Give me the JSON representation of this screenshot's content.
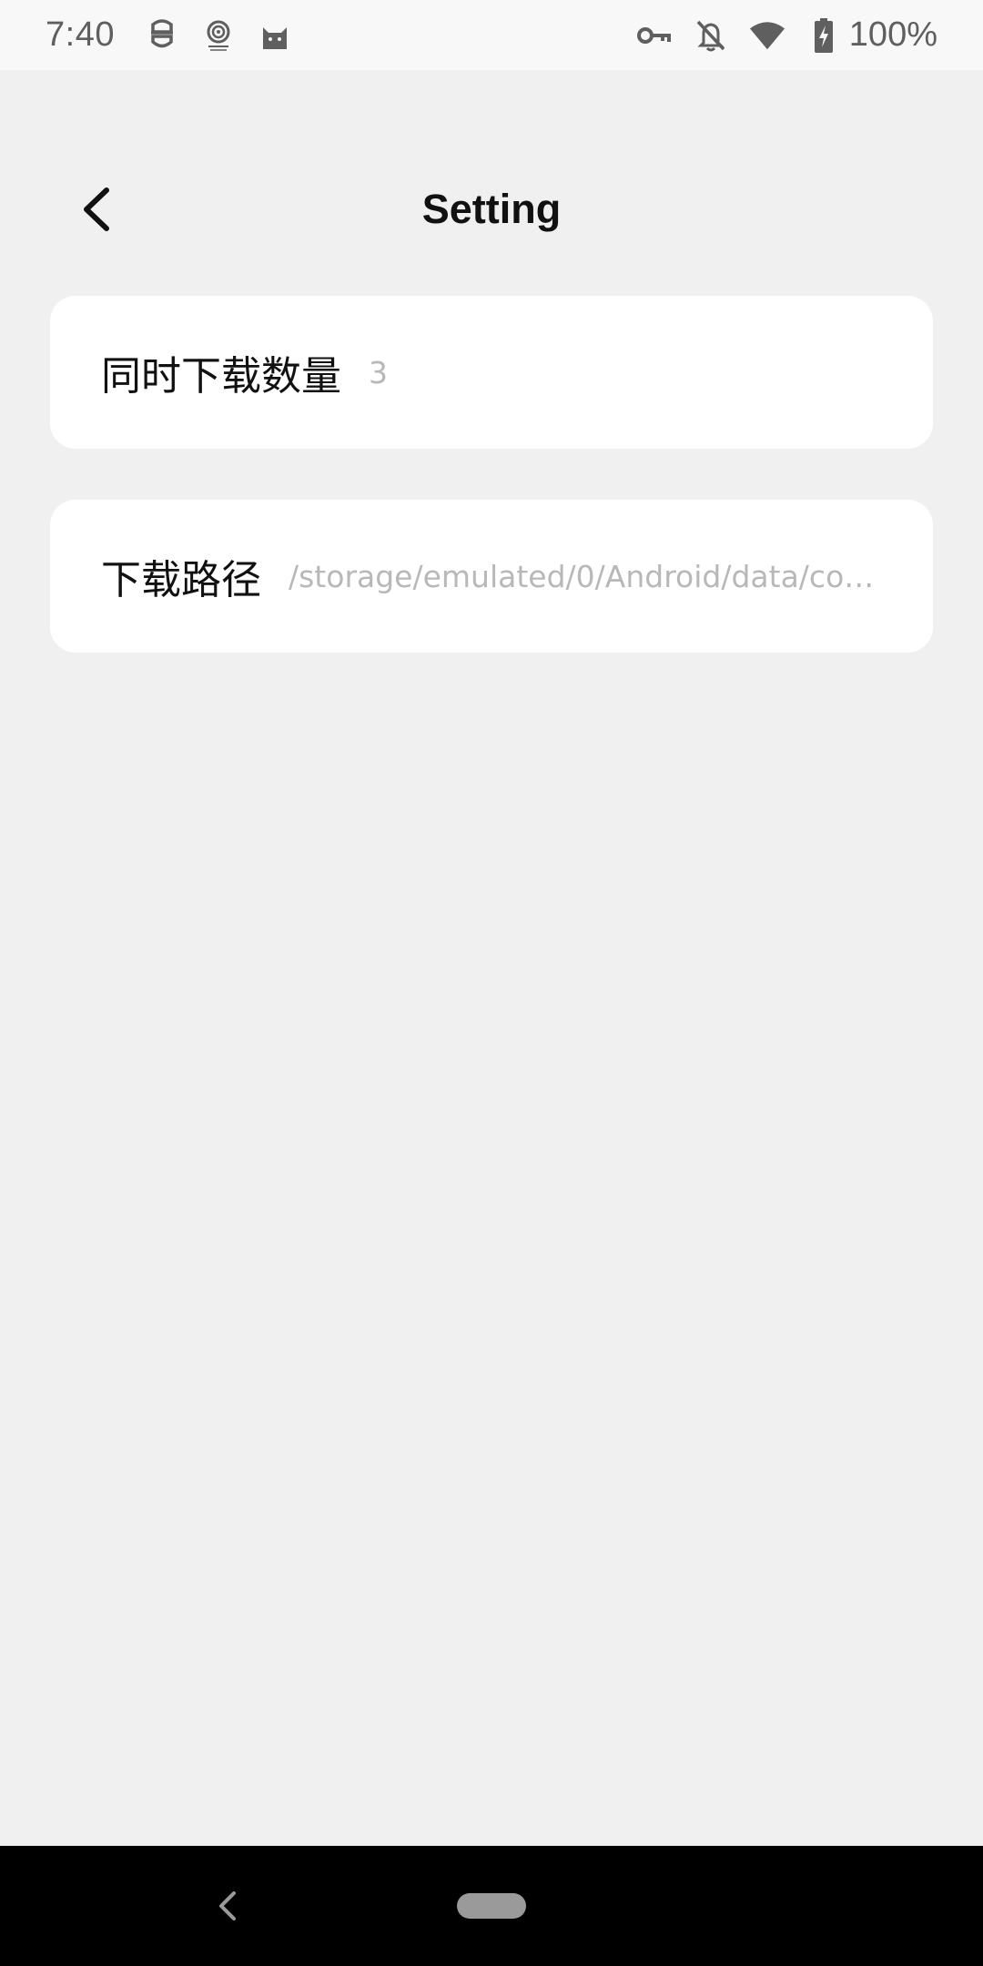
{
  "status_bar": {
    "time": "7:40",
    "battery": "100%",
    "left_icons": [
      "robot-icon",
      "fingerprint-app-icon",
      "cat-icon"
    ],
    "right_icons": [
      "vpn-key-icon",
      "notifications-off-icon",
      "wifi-icon",
      "battery-charging-icon"
    ]
  },
  "header": {
    "title": "Setting",
    "back_icon": "chevron-left-icon"
  },
  "settings": [
    {
      "label": "同时下载数量",
      "value": "3"
    },
    {
      "label": "下载路径",
      "value": "/storage/emulated/0/Android/data/co…"
    }
  ],
  "nav_bar": {
    "back_icon": "nav-back-icon",
    "home_icon": "nav-home-pill"
  },
  "colors": {
    "background": "#f0f0f0",
    "card": "#ffffff",
    "value_text": "#b8b8b8",
    "nav_bar": "#000000"
  }
}
